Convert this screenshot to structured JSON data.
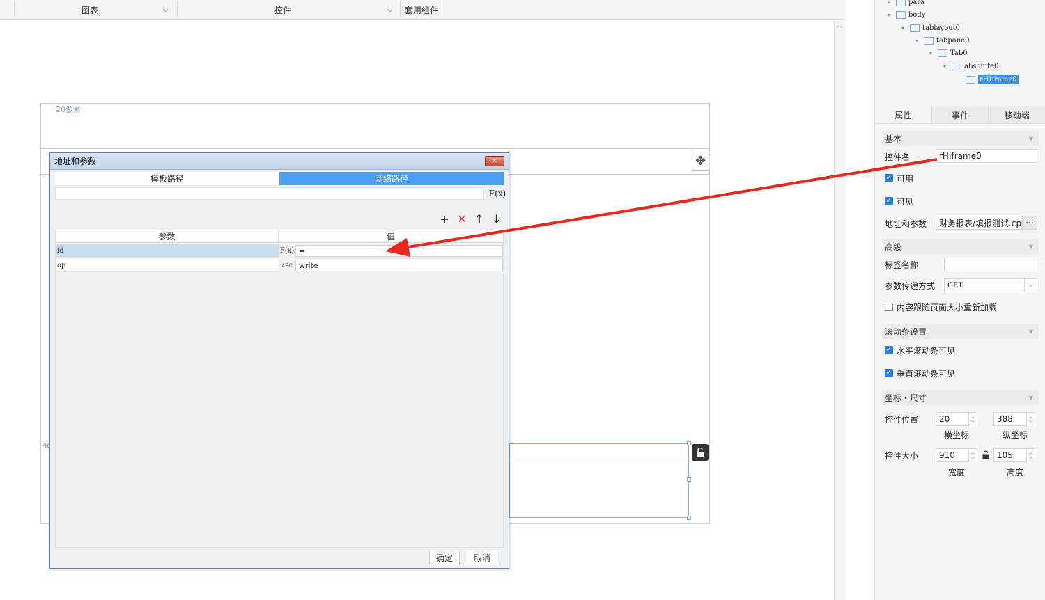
{
  "toolbar": {
    "chart_label": "图表",
    "widget_label": "控件",
    "template_widget_label": "套用组件"
  },
  "canvas": {
    "ruler_label": "20像素",
    "ruler_label_left": "48"
  },
  "tree": {
    "items": [
      {
        "label": "para"
      },
      {
        "label": "body"
      },
      {
        "label": "tablayout0"
      },
      {
        "label": "tabpane0"
      },
      {
        "label": "Tab0"
      },
      {
        "label": "absolute0"
      },
      {
        "label": "rHIframe0"
      }
    ]
  },
  "right_tabs": [
    "属性",
    "事件",
    "移动端"
  ],
  "props": {
    "basic_section": "基本",
    "widget_name_label": "控件名",
    "widget_name_value": "rHIframe0",
    "enabled_label": "可用",
    "visible_label": "可见",
    "address_label": "地址和参数",
    "address_value": "财务报表/填报测试.cpt",
    "more_icon": "···",
    "advanced_section": "高级",
    "tag_name_label": "标签名称",
    "tag_name_value": "",
    "param_method_label": "参数传递方式",
    "param_method_value": "GET",
    "reload_label": "内容跟随页面大小重新加载",
    "scroll_section": "滚动条设置",
    "hscroll_label": "水平滚动条可见",
    "vscroll_label": "垂直滚动条可见",
    "coord_section": "坐标・尺寸",
    "position_label": "控件位置",
    "pos_x": "20",
    "pos_y": "388",
    "x_caption": "横坐标",
    "y_caption": "纵坐标",
    "size_label": "控件大小",
    "width": "910",
    "height": "105",
    "width_caption": "宽度",
    "height_caption": "高度"
  },
  "dialog": {
    "title": "地址和参数",
    "close_glyph": "✕",
    "tab_template": "模板路径",
    "tab_network": "网络路径",
    "url_value": "",
    "fx_label": "F(x)",
    "col_param": "参数",
    "col_value": "值",
    "rows": [
      {
        "name": "id",
        "type": "F(x)",
        "value": "="
      },
      {
        "name": "op",
        "type": "ABC",
        "value": "write"
      }
    ],
    "ok_label": "确定",
    "cancel_label": "取消"
  },
  "colors": {
    "accent": "#4a9ff5",
    "selection": "#c9dcee",
    "arrow": "#e8281e"
  }
}
